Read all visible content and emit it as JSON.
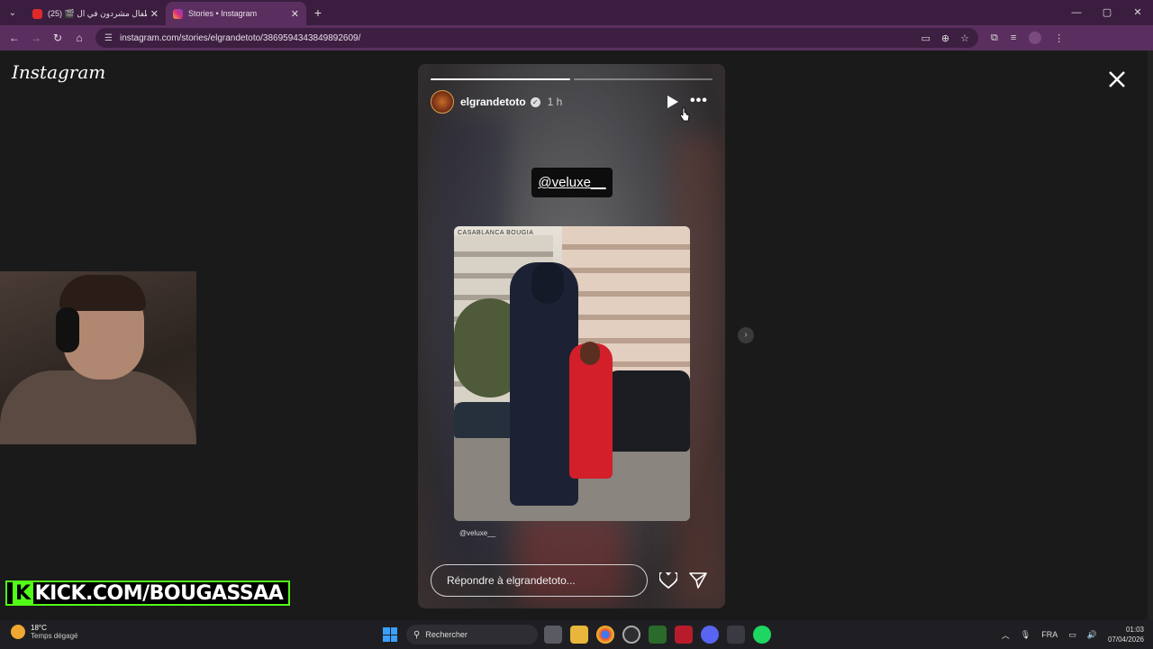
{
  "browser": {
    "tabs": [
      {
        "title": "(25) 🎬 اطفال مشردون في ال...",
        "favicon_color": "#e02a2a",
        "active": false
      },
      {
        "title": "Stories • Instagram",
        "favicon_color": "#d6307a",
        "active": true
      }
    ],
    "new_tab": "+",
    "window_controls": [
      "—",
      "▢",
      "✕"
    ],
    "url": "instagram.com/stories/elgrandetoto/3869594343849892609/"
  },
  "page": {
    "logo": "Instagram",
    "story": {
      "username": "elgrandetoto",
      "verified": "✓",
      "time": "1 h",
      "more": "•••",
      "mention_sticker": "@veluxe__",
      "photo_caption": "CASABLANCA BOUGIA",
      "credit": "@veluxe__",
      "reply_placeholder": "Répondre à elgrandetoto...",
      "progress": [
        1.0,
        0.0
      ]
    },
    "next": "›"
  },
  "overlay": {
    "kick_banner": "KICK.COM/BOUGASSAA",
    "kick_k": "K"
  },
  "taskbar": {
    "weather_temp": "18°C",
    "weather_desc": "Temps dégagé",
    "search": "Rechercher",
    "language": "FRA",
    "time": "01:03",
    "date": "07/04/2026"
  }
}
